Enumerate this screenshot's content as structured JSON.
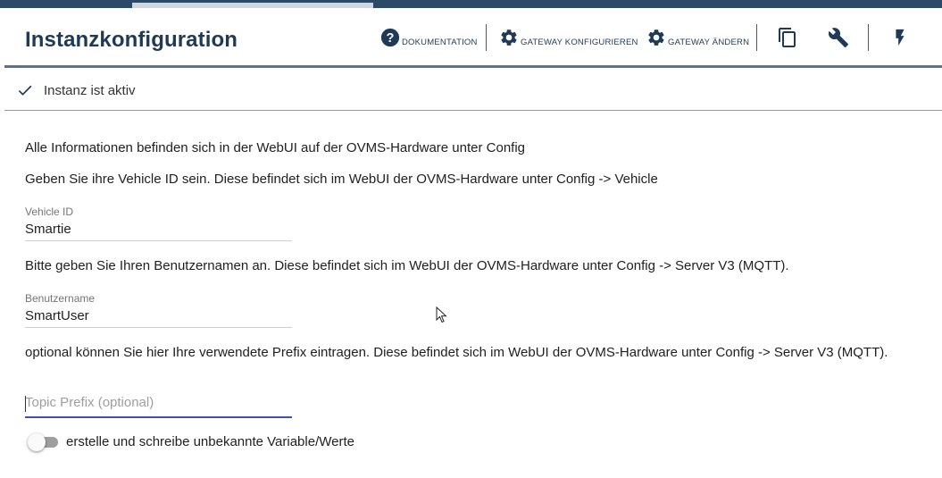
{
  "header": {
    "title": "Instanzkonfiguration",
    "buttons": [
      {
        "icon": "help-circle-icon",
        "label": "DOKUMENTATION"
      },
      {
        "icon": "gear-icon",
        "label": "GATEWAY KONFIGURIEREN"
      },
      {
        "icon": "gear-icon",
        "label": "GATEWAY ÄNDERN"
      },
      {
        "icon": "copy-icon",
        "label": ""
      },
      {
        "icon": "wrench-icon",
        "label": ""
      },
      {
        "icon": "lightning-icon",
        "label": ""
      }
    ]
  },
  "status": {
    "icon": "check-icon",
    "text": "Instanz ist aktiv"
  },
  "content": {
    "info1": "Alle Informationen befinden sich in der WebUI auf der OVMS-Hardware unter Config",
    "info2": "Geben Sie ihre Vehicle ID sein. Diese befindet sich im WebUI der OVMS-Hardware unter Config -> Vehicle",
    "vehicle_id": {
      "label": "Vehicle ID",
      "value": "Smartie"
    },
    "info3": "Bitte geben Sie Ihren Benutzernamen an. Diese befindet sich im WebUI der OVMS-Hardware unter Config -> Server V3 (MQTT).",
    "username": {
      "label": "Benutzername",
      "value": "SmartUser"
    },
    "info4": "optional können Sie hier Ihre verwendete Prefix eintragen. Diese befindet sich im WebUI der OVMS-Hardware unter Config -> Server V3 (MQTT).",
    "topic_prefix": {
      "placeholder": "Topic Prefix (optional)",
      "value": ""
    },
    "toggle": {
      "label": "erstelle und schreibe unbekannte Variable/Werte",
      "checked": false
    }
  },
  "colors": {
    "accent": "#1f3a57",
    "topbar": "#2c4a68",
    "focus": "#3f51b5"
  }
}
